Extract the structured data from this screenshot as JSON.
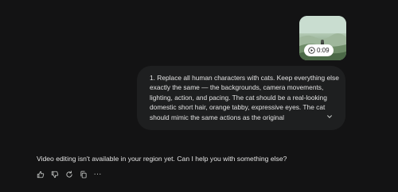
{
  "video": {
    "duration": "0:09",
    "icon": "play-icon"
  },
  "prompt": {
    "text": "1. Replace all human characters with cats. Keep everything else exactly the same — the backgrounds, camera movements, lighting, action, and pacing. The cat should be a real-looking domestic short hair, orange tabby, expressive eyes. The cat should mimic the same actions as the original",
    "expand_icon": "chevron-down-icon"
  },
  "response": {
    "text": "Video editing isn't available in your region yet. Can I help you with something else?"
  },
  "actions": [
    {
      "icon": "thumbs-up-icon"
    },
    {
      "icon": "thumbs-down-icon"
    },
    {
      "icon": "regenerate-icon"
    },
    {
      "icon": "copy-icon"
    },
    {
      "icon": "more-icon",
      "label": "···"
    }
  ],
  "colors": {
    "background": "#131314",
    "bubble": "#1e1f20",
    "text": "#e3e3e3",
    "icon": "#c4c7c5"
  }
}
